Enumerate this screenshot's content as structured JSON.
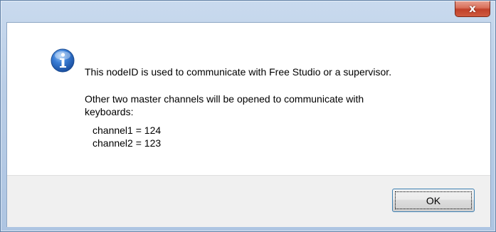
{
  "dialog": {
    "close_symbol": "x",
    "icon": "information-icon",
    "message_line1": "This nodeID is used to communicate with Free Studio or a supervisor.",
    "message_line2": "Other two master channels will be opened to communicate with",
    "message_line3": "keyboards:",
    "channel1": "channel1 = 124",
    "channel2": "channel2 = 123",
    "ok_label": "OK"
  },
  "colors": {
    "close_button": "#c7432b",
    "icon_blue": "#1e5fb8",
    "focus_border": "#3c7fb1"
  }
}
